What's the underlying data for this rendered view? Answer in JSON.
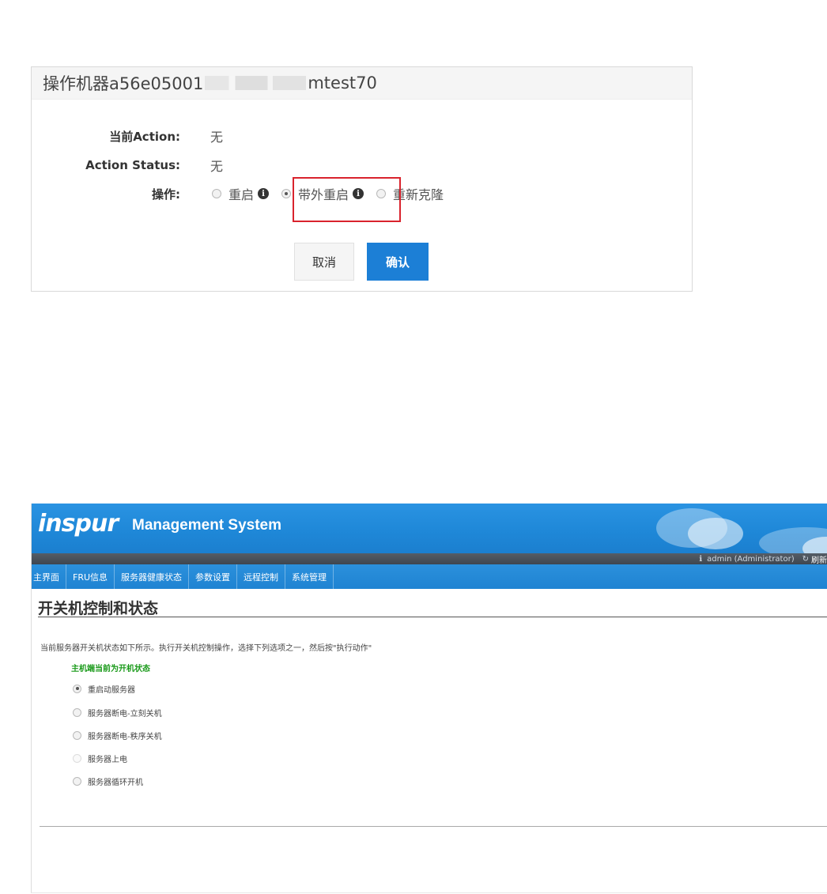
{
  "dialog": {
    "title_prefix": "操作机器a56e05001",
    "title_suffix": "mtest70",
    "fields": {
      "current_action_label": "当前Action:",
      "current_action_value": "无",
      "action_status_label": "Action Status:",
      "action_status_value": "无",
      "operation_label": "操作:"
    },
    "options": [
      {
        "label": "重启",
        "checked": false
      },
      {
        "label": "带外重启",
        "checked": true
      },
      {
        "label": "重新克隆",
        "checked": false
      }
    ],
    "cancel_label": "取消",
    "confirm_label": "确认",
    "colors": {
      "confirm": "#1c7fd6",
      "highlight": "#d9232d"
    }
  },
  "bmc": {
    "logo": "inspur",
    "title": "Management System",
    "user": "admin (Administrator)",
    "refresh": "刷新",
    "nav": [
      "主界面",
      "FRU信息",
      "服务器健康状态",
      "参数设置",
      "远程控制",
      "系统管理"
    ],
    "page_title": "开关机控制和状态",
    "description": "当前服务器开关机状态如下所示。执行开关机控制操作，选择下列选项之一，然后按\"执行动作\"",
    "status": "主机端当前为开机状态",
    "options": [
      {
        "label": "重启动服务器",
        "checked": true,
        "disabled": false
      },
      {
        "label": "服务器断电-立刻关机",
        "checked": false,
        "disabled": false
      },
      {
        "label": "服务器断电-秩序关机",
        "checked": false,
        "disabled": false
      },
      {
        "label": "服务器上电",
        "checked": false,
        "disabled": true
      },
      {
        "label": "服务器循环开机",
        "checked": false,
        "disabled": false
      }
    ],
    "colors": {
      "header": "#1f88d8",
      "status": "#1a9a1a"
    }
  }
}
